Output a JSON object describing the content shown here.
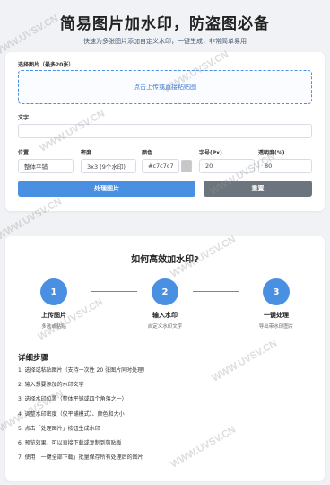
{
  "header": {
    "title": "简易图片加水印，防盗图必备",
    "subtitle": "快速为多张图片添加自定义水印，一键生成，非常简单易用"
  },
  "form": {
    "select_label": "选择图片（最多20张）",
    "dropzone_text": "点击上传或直接粘贴图",
    "text_label": "文字",
    "text_value": "",
    "position_label": "位置",
    "position_value": "整体平铺",
    "density_label": "密度",
    "density_value": "3x3 (9个水印)",
    "color_label": "颜色",
    "color_value": "#c7c7c7",
    "fontsize_label": "字号(Px)",
    "fontsize_value": "20",
    "opacity_label": "透明度(%)",
    "opacity_value": "80",
    "process_button": "处理图片",
    "reset_button": "重置"
  },
  "how": {
    "title": "如何高效加水印?",
    "steps": [
      {
        "num": "1",
        "title": "上传图片",
        "desc": "多选或粘贴"
      },
      {
        "num": "2",
        "title": "输入水印",
        "desc": "自定义水印文字"
      },
      {
        "num": "3",
        "title": "一键处理",
        "desc": "导出带水印图片"
      }
    ],
    "detail_title": "详细步骤",
    "details": [
      "1. 选择或粘贴图片（支持一次性 20 张图片同时处理）",
      "2. 输入想要添加的水印文字",
      "3. 选择水印位置（整体平铺或四个角落之一）",
      "4. 调整水印密度（仅平铺模式）、颜色和大小",
      "5. 点击「处理图片」按钮生成水印",
      "6. 预览效果，可以直接下载或复制到剪贴板",
      "7. 使用「一键全部下载」批量保存所有处理后的图片"
    ]
  },
  "watermark_text": "WWW.UVSV.CN",
  "colors": {
    "accent": "#4a90e2",
    "reset": "#6c757d",
    "background": "#f0f2f5"
  }
}
